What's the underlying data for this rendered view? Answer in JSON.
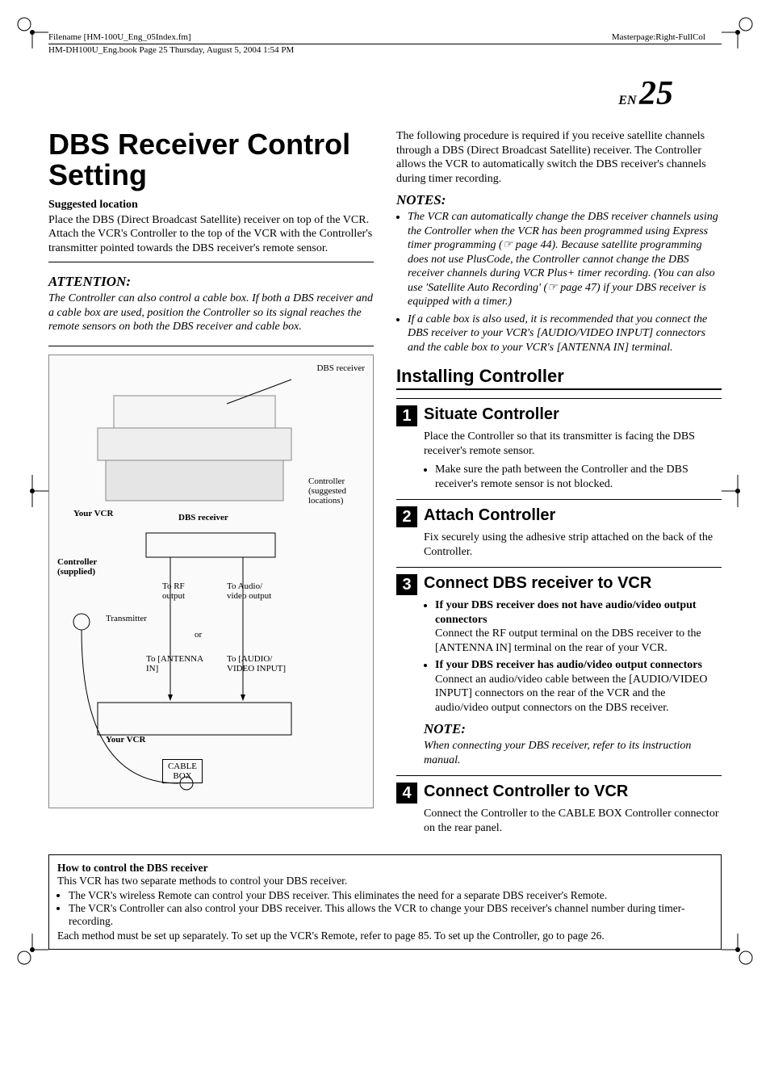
{
  "header": {
    "filename_line": "Filename [HM-100U_Eng_05Index.fm]",
    "book_line": "HM-DH100U_Eng.book  Page 25  Thursday, August 5, 2004  1:54 PM",
    "masterpage": "Masterpage:Right-FullCol"
  },
  "page": {
    "en": "EN",
    "num": "25"
  },
  "left": {
    "title": "DBS Receiver Control Setting",
    "suggested_head": "Suggested location",
    "suggested_body": "Place the DBS (Direct Broadcast Satellite) receiver on top of the VCR. Attach the VCR's Controller to the top of the VCR with the Controller's transmitter pointed towards the DBS receiver's remote sensor.",
    "attention_label": "ATTENTION:",
    "attention_body": "The Controller can also control a cable box. If both a DBS receiver and a cable box are used, position the Controller so its signal reaches the remote sensors on both the DBS receiver and cable box.",
    "fig": {
      "dbs_receiver": "DBS receiver",
      "controller_loc": "Controller (suggested locations)",
      "your_vcr": "Your VCR",
      "dbs_receiver2": "DBS receiver",
      "controller_supplied": "Controller (supplied)",
      "transmitter": "Transmitter",
      "to_rf": "To RF output",
      "to_av": "To Audio/ video output",
      "or": "or",
      "to_ant": "To [ANTENNA IN]",
      "to_av_in": "To [AUDIO/ VIDEO INPUT]",
      "your_vcr2": "Your VCR",
      "cable_box": "CABLE BOX"
    }
  },
  "right": {
    "intro": "The following procedure is required if you receive satellite channels through a DBS (Direct Broadcast Satellite) receiver. The Controller allows the VCR to automatically switch the DBS receiver's channels during timer recording.",
    "notes_label": "NOTES:",
    "notes": [
      "The VCR can automatically change the DBS receiver channels using the Controller when the VCR has been programmed using Express timer programming (☞  page 44). Because satellite programming does not use PlusCode, the Controller cannot change the DBS receiver channels during VCR Plus+ timer recording. (You can also use 'Satellite Auto Recording' (☞  page 47) if your DBS receiver is equipped with a timer.)",
      "If a cable box is also used, it is recommended that you connect the DBS receiver to your VCR's [AUDIO/VIDEO INPUT] connectors and the cable box to your VCR's [ANTENNA IN] terminal."
    ],
    "section": "Installing Controller",
    "steps": [
      {
        "num": "1",
        "title": "Situate Controller",
        "body": "Place the Controller so that its transmitter is facing the DBS receiver's remote sensor.",
        "bullets": [
          "Make sure the path between the Controller and the DBS receiver's remote sensor is not blocked."
        ]
      },
      {
        "num": "2",
        "title": "Attach Controller",
        "body": "Fix securely using the adhesive strip attached on the back of the Controller."
      },
      {
        "num": "3",
        "title": "Connect DBS receiver to VCR",
        "sub": [
          {
            "head": "If your DBS receiver does not have audio/video output connectors",
            "body": "Connect the RF output terminal on the DBS receiver to the [ANTENNA IN] terminal on the rear of your VCR."
          },
          {
            "head": "If your DBS receiver has audio/video output connectors",
            "body": "Connect an audio/video cable between the [AUDIO/VIDEO INPUT] connectors on the rear of the VCR and the audio/video output connectors on the DBS receiver."
          }
        ],
        "note_label": "NOTE:",
        "note_body": "When connecting your DBS receiver, refer to its instruction manual."
      },
      {
        "num": "4",
        "title": "Connect Controller to VCR",
        "body": "Connect the Controller to the CABLE BOX Controller connector on the rear panel."
      }
    ]
  },
  "footer": {
    "head": "How to control the DBS receiver",
    "intro": "This VCR has two separate methods to control your DBS receiver.",
    "bullets": [
      "The VCR's wireless Remote can control your DBS receiver. This eliminates the need for a separate DBS receiver's Remote.",
      "The VCR's Controller can also control your DBS receiver. This allows the VCR to change your DBS receiver's channel number during timer-recording."
    ],
    "outro": "Each method must be set up separately. To set up the VCR's Remote, refer to page 85. To set up the Controller, go to page 26."
  }
}
